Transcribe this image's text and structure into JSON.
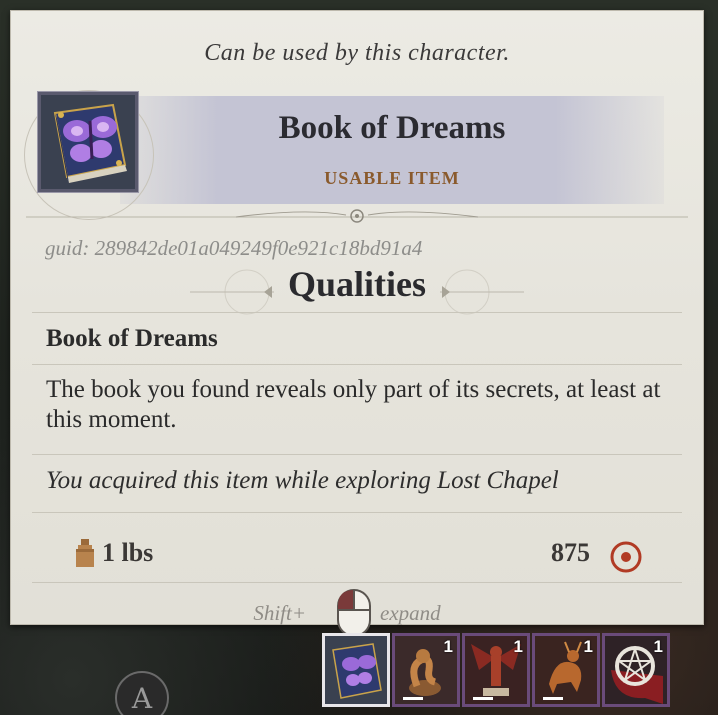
{
  "tooltip": {
    "usable_note": "Can be used by this character.",
    "item_name": "Book of Dreams",
    "item_type": "USABLE ITEM",
    "item_icon": "purple-butterfly-book-icon",
    "guid": "guid: 289842de01a049249f0e921c18bd91a4",
    "section_title": "Qualities",
    "quality_name": "Book of Dreams",
    "description": "The book you found reveals only part of its secrets, at least at this moment.",
    "acquired": "You acquired this item while exploring Lost Chapel",
    "weight": "1 lbs",
    "cost": "875",
    "hint_modifier": "Shift+",
    "hint_action": "expand",
    "colors": {
      "parchment": "#e6e4dc",
      "banner": "#c4c4d4",
      "type_label": "#8a5a2c",
      "coin": "#b13a24",
      "slot_border": "#6a4b7a"
    }
  },
  "inventory": {
    "slots": [
      {
        "icon": "book-of-dreams-icon",
        "count": "",
        "selected": true
      },
      {
        "icon": "serpent-figurine-icon",
        "count": "1",
        "selected": false
      },
      {
        "icon": "winged-demon-figurine-icon",
        "count": "1",
        "selected": false
      },
      {
        "icon": "demon-beast-figurine-icon",
        "count": "1",
        "selected": false
      },
      {
        "icon": "pentagram-amulet-icon",
        "count": "1",
        "selected": false
      }
    ]
  }
}
